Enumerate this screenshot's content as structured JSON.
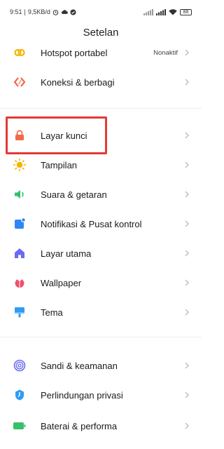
{
  "status_bar": {
    "time": "9:51",
    "speed": "9,5KB/d",
    "battery": "88"
  },
  "header": {
    "title": "Setelan"
  },
  "rows": [
    {
      "label": "Hotspot portabel",
      "value": "Nonaktif",
      "icon": "hotspot-icon",
      "color": "#f5b400"
    },
    {
      "label": "Koneksi & berbagi",
      "icon": "connection-share-icon",
      "color": "#ef6a4c"
    },
    {
      "label": "Layar kunci",
      "icon": "lock-icon",
      "color": "#ef6a4c"
    },
    {
      "label": "Tampilan",
      "icon": "sun-icon",
      "color": "#f5b400"
    },
    {
      "label": "Suara & getaran",
      "icon": "speaker-icon",
      "color": "#35c06b"
    },
    {
      "label": "Notifikasi & Pusat kontrol",
      "icon": "notification-icon",
      "color": "#2f86f6"
    },
    {
      "label": "Layar utama",
      "icon": "home-icon",
      "color": "#6b6bf2"
    },
    {
      "label": "Wallpaper",
      "icon": "wallpaper-icon",
      "color": "#ef4f6a"
    },
    {
      "label": "Tema",
      "icon": "theme-icon",
      "color": "#2f9cf6"
    },
    {
      "label": "Sandi & keamanan",
      "icon": "fingerprint-icon",
      "color": "#6b6bf2"
    },
    {
      "label": "Perlindungan privasi",
      "icon": "privacy-icon",
      "color": "#2f9cf6"
    },
    {
      "label": "Baterai & performa",
      "icon": "battery-icon",
      "color": "#35c06b"
    }
  ],
  "highlight_color": "#e53935"
}
